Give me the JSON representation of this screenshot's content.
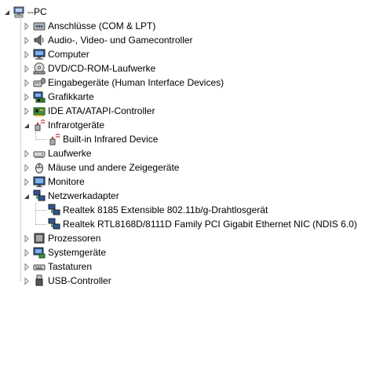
{
  "tree": {
    "root": {
      "label": "--PC",
      "icon": "computer-root-icon",
      "expanded": true
    },
    "categories": [
      {
        "label": "Anschlüsse (COM & LPT)",
        "icon": "port-icon",
        "expanded": false
      },
      {
        "label": "Audio-, Video- und Gamecontroller",
        "icon": "speaker-icon",
        "expanded": false
      },
      {
        "label": "Computer",
        "icon": "computer-icon",
        "expanded": false
      },
      {
        "label": "DVD/CD-ROM-Laufwerke",
        "icon": "dvd-drive-icon",
        "expanded": false
      },
      {
        "label": "Eingabegeräte (Human Interface Devices)",
        "icon": "hid-icon",
        "expanded": false
      },
      {
        "label": "Grafikkarte",
        "icon": "display-adapter-icon",
        "expanded": false
      },
      {
        "label": "IDE ATA/ATAPI-Controller",
        "icon": "ide-controller-icon",
        "expanded": false
      },
      {
        "label": "Infrarotgeräte",
        "icon": "infrared-icon",
        "expanded": true,
        "children": [
          {
            "label": "Built-in Infrared Device",
            "icon": "infrared-device-icon"
          }
        ]
      },
      {
        "label": "Laufwerke",
        "icon": "disk-drive-icon",
        "expanded": false
      },
      {
        "label": "Mäuse und andere Zeigegeräte",
        "icon": "mouse-icon",
        "expanded": false
      },
      {
        "label": "Monitore",
        "icon": "monitor-icon",
        "expanded": false
      },
      {
        "label": "Netzwerkadapter",
        "icon": "network-adapter-icon",
        "expanded": true,
        "children": [
          {
            "label": "Realtek 8185 Extensible 802.11b/g-Drahtlosgerät",
            "icon": "network-card-icon"
          },
          {
            "label": "Realtek RTL8168D/8111D Family PCI Gigabit Ethernet NIC (NDIS 6.0)",
            "icon": "network-card-icon"
          }
        ]
      },
      {
        "label": "Prozessoren",
        "icon": "processor-icon",
        "expanded": false
      },
      {
        "label": "Systemgeräte",
        "icon": "system-devices-icon",
        "expanded": false
      },
      {
        "label": "Tastaturen",
        "icon": "keyboard-icon",
        "expanded": false
      },
      {
        "label": "USB-Controller",
        "icon": "usb-icon",
        "expanded": false
      }
    ]
  },
  "colors": {
    "background": "#ffffff",
    "tree_line": "#a0a0a0",
    "toggle_collapsed": "#808080",
    "toggle_expanded": "#404040"
  }
}
